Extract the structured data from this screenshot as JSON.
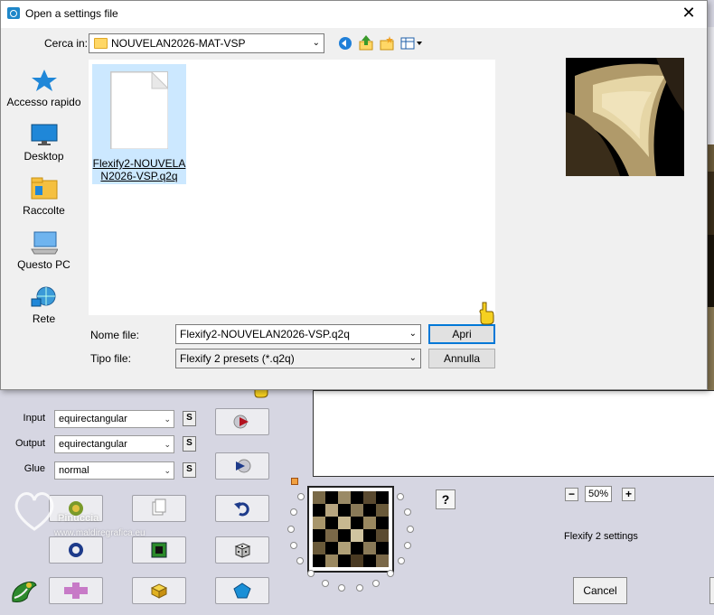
{
  "dialog": {
    "title": "Open a settings file",
    "close_icon": "close-icon",
    "lookin_label": "Cerca in:",
    "lookin_value": "NOUVELAN2026-MAT-VSP",
    "toolbar_icons": [
      "back-icon",
      "up-folder-icon",
      "new-folder-icon",
      "view-menu-icon"
    ],
    "places": [
      {
        "label": "Accesso rapido",
        "icon": "star-icon"
      },
      {
        "label": "Desktop",
        "icon": "desktop-icon"
      },
      {
        "label": "Raccolte",
        "icon": "libraries-icon"
      },
      {
        "label": "Questo PC",
        "icon": "computer-icon"
      },
      {
        "label": "Rete",
        "icon": "network-icon"
      }
    ],
    "files": [
      {
        "name": "Flexify2-NOUVELAN2026-VSP.q2q",
        "selected": true
      }
    ],
    "filename_label": "Nome file:",
    "filename_value": "Flexify2-NOUVELAN2026-VSP.q2q",
    "filetype_label": "Tipo file:",
    "filetype_value": "Flexify 2 presets (*.q2q)",
    "open_button": "Apri",
    "cancel_button": "Annulla"
  },
  "app": {
    "input_label": "Input",
    "input_value": "equirectangular",
    "output_label": "Output",
    "output_value": "equirectangular",
    "glue_label": "Glue",
    "glue_value": "normal",
    "s_label": "S",
    "zoom_minus": "−",
    "zoom_value": "50%",
    "zoom_plus": "+",
    "help": "?",
    "settings_label": "Flexify 2 settings",
    "cancel_label": "Cancel"
  },
  "watermark": {
    "name": "Pinuccia",
    "url": "www.maldiregrafica.eu"
  },
  "colors": {
    "accent": "#0078d7",
    "selection": "#cce8ff",
    "app_bg": "#d6d6e2"
  }
}
